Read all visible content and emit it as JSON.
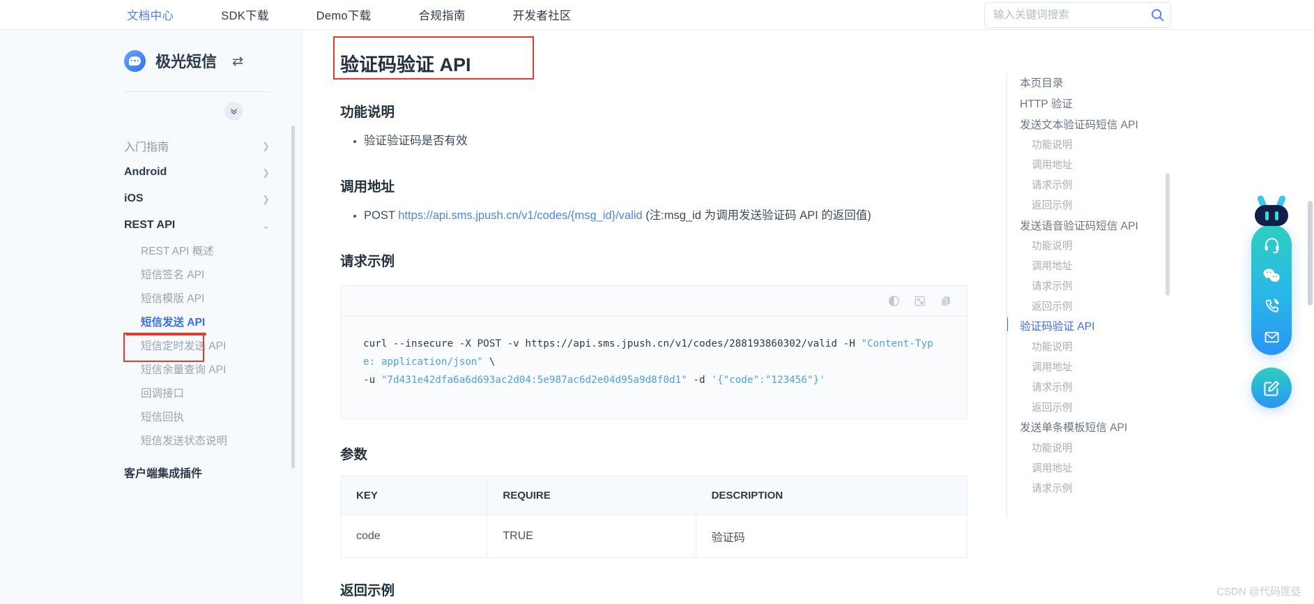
{
  "topnav": {
    "items": [
      {
        "label": "文档中心",
        "active": true
      },
      {
        "label": "SDK下载",
        "active": false
      },
      {
        "label": "Demo下载",
        "active": false
      },
      {
        "label": "合规指南",
        "active": false
      },
      {
        "label": "开发者社区",
        "active": false
      }
    ],
    "search": {
      "placeholder": "输入关键词搜索",
      "value": "",
      "icon": "search-icon"
    }
  },
  "sidebar": {
    "brand": {
      "name": "极光短信",
      "logo_icon": "chat-bubble-logo",
      "swap_icon": "swap-arrows-icon"
    },
    "collapse_icon": "chevron-double-down-icon",
    "groups": [
      {
        "label": "入门指南",
        "state": "collapsed",
        "muted": true
      },
      {
        "label": "Android",
        "state": "collapsed",
        "muted": false
      },
      {
        "label": "iOS",
        "state": "collapsed",
        "muted": false
      },
      {
        "label": "REST API",
        "state": "expanded",
        "muted": false
      }
    ],
    "rest_api_items": [
      {
        "label": "REST API 概述",
        "active": false
      },
      {
        "label": "短信签名 API",
        "active": false
      },
      {
        "label": "短信模版 API",
        "active": false
      },
      {
        "label": "短信发送 API",
        "active": true,
        "highlighted": true
      },
      {
        "label": "短信定时发送 API",
        "active": false
      },
      {
        "label": "短信余量查询 API",
        "active": false
      },
      {
        "label": "回调接口",
        "active": false
      },
      {
        "label": "短信回执",
        "active": false
      },
      {
        "label": "短信发送状态说明",
        "active": false
      }
    ],
    "bottom_group": {
      "label": "客户端集成插件"
    }
  },
  "main": {
    "title": "验证码验证 API",
    "sections": [
      {
        "heading": "功能说明",
        "bullets": [
          "验证验证码是否有效"
        ]
      },
      {
        "heading": "调用地址"
      }
    ],
    "endpoint": {
      "method": "POST",
      "url": "https://api.sms.jpush.cn/v1/codes/{msg_id}/valid",
      "note": "(注:msg_id 为调用发送验证码 API 的返回值)"
    },
    "request_heading": "请求示例",
    "code_toolbar": [
      {
        "icon": "contrast-theme-icon"
      },
      {
        "icon": "expand-fullscreen-icon"
      },
      {
        "icon": "copy-icon"
      }
    ],
    "code": {
      "line1_plain": "curl --insecure -X POST -v https://api.sms.jpush.cn/v1/codes/288193860302/valid -H ",
      "line1_str": "\"Content-Type: application/json\"",
      "line1_tail": " \\",
      "line2_plain": "-u ",
      "line2_str": "\"7d431e42dfa6a6d693ac2d04:5e987ac6d2e04d95a9d8f0d1\"",
      "line2_mid": " -d ",
      "line2_str2": "'{\"code\":\"123456\"}'"
    },
    "params_heading": "参数",
    "params_table": {
      "columns": [
        "KEY",
        "REQUIRE",
        "DESCRIPTION"
      ],
      "rows": [
        [
          "code",
          "TRUE",
          "验证码"
        ]
      ]
    },
    "next_heading": "返回示例"
  },
  "toc": {
    "items": [
      {
        "label": "本页目录",
        "level": 1,
        "active": false
      },
      {
        "label": "HTTP 验证",
        "level": 1,
        "active": false
      },
      {
        "label": "发送文本验证码短信 API",
        "level": 1,
        "active": false
      },
      {
        "label": "功能说明",
        "level": 2,
        "active": false
      },
      {
        "label": "调用地址",
        "level": 2,
        "active": false
      },
      {
        "label": "请求示例",
        "level": 2,
        "active": false
      },
      {
        "label": "返回示例",
        "level": 2,
        "active": false
      },
      {
        "label": "发送语音验证码短信 API",
        "level": 1,
        "active": false
      },
      {
        "label": "功能说明",
        "level": 2,
        "active": false
      },
      {
        "label": "调用地址",
        "level": 2,
        "active": false
      },
      {
        "label": "请求示例",
        "level": 2,
        "active": false
      },
      {
        "label": "返回示例",
        "level": 2,
        "active": false
      },
      {
        "label": "验证码验证 API",
        "level": 1,
        "active": true
      },
      {
        "label": "功能说明",
        "level": 2,
        "active": false
      },
      {
        "label": "调用地址",
        "level": 2,
        "active": false
      },
      {
        "label": "请求示例",
        "level": 2,
        "active": false
      },
      {
        "label": "返回示例",
        "level": 2,
        "active": false
      },
      {
        "label": "发送单条模板短信 API",
        "level": 1,
        "active": false
      },
      {
        "label": "功能说明",
        "level": 2,
        "active": false
      },
      {
        "label": "调用地址",
        "level": 2,
        "active": false
      },
      {
        "label": "请求示例",
        "level": 2,
        "active": false
      }
    ]
  },
  "float_widget": {
    "robot_icon": "robot-head-icon",
    "actions": [
      {
        "icon": "headset-support-icon"
      },
      {
        "icon": "wechat-icon"
      },
      {
        "icon": "phone-call-icon"
      },
      {
        "icon": "mail-envelope-icon"
      }
    ],
    "edit_icon": "edit-pencil-icon"
  },
  "watermark": "CSDN @代码匪徒",
  "colors": {
    "accent_blue": "#3a6df0",
    "link_blue": "#4a86e8",
    "annotation_red": "#e8392a",
    "sidebar_bg": "#f7fafd"
  }
}
